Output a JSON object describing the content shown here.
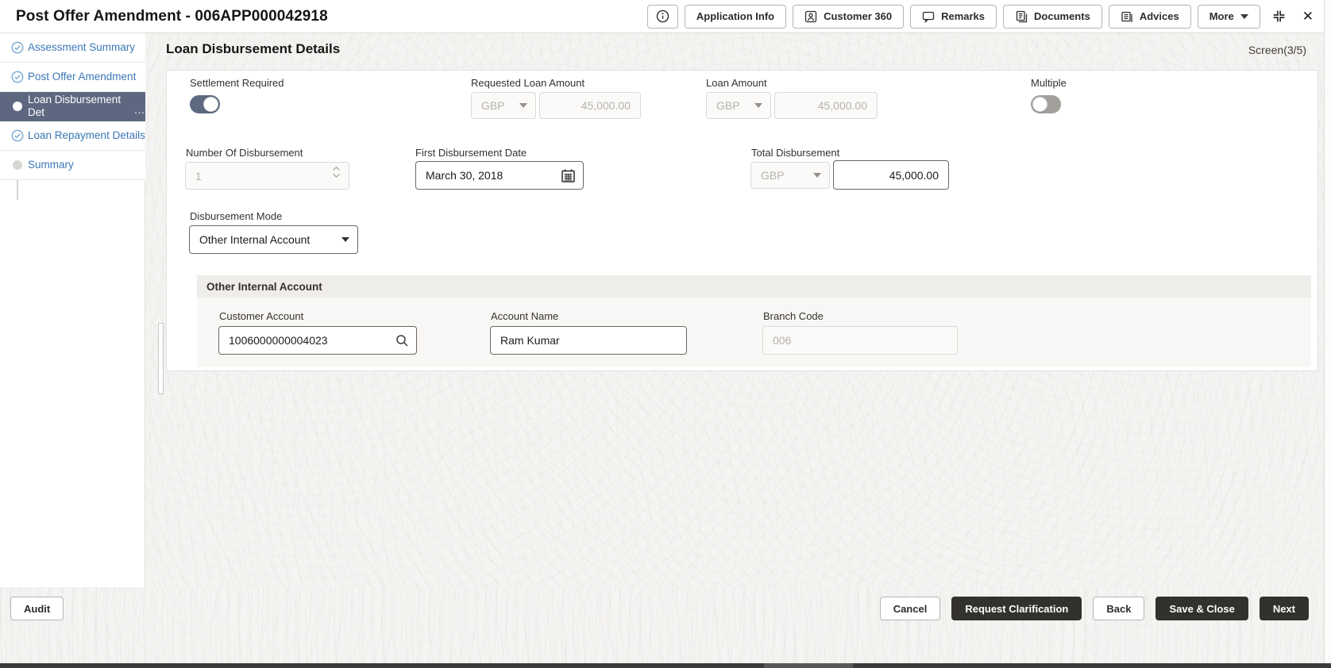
{
  "header": {
    "title": "Post Offer Amendment - 006APP000042918",
    "buttons": {
      "application_info": "Application Info",
      "customer_360": "Customer 360",
      "remarks": "Remarks",
      "documents": "Documents",
      "advices": "Advices",
      "more": "More"
    },
    "close_glyph": "✕"
  },
  "sidebar": {
    "items": [
      {
        "label": "Assessment Summary",
        "state": "completed"
      },
      {
        "label": "Post Offer Amendment",
        "state": "completed"
      },
      {
        "label": "Loan Disbursement Det",
        "ellipsis": "...",
        "state": "active"
      },
      {
        "label": "Loan Repayment Details",
        "state": "completed"
      },
      {
        "label": "Summary",
        "state": "pending"
      }
    ]
  },
  "main": {
    "title": "Loan Disbursement Details",
    "screen_indicator": "Screen(3/5)",
    "fields": {
      "settlement_required": {
        "label": "Settlement Required",
        "value": "on"
      },
      "requested_loan_amount": {
        "label": "Requested Loan Amount",
        "currency": "GBP",
        "amount": "45,000.00",
        "state": "disabled"
      },
      "loan_amount": {
        "label": "Loan Amount",
        "currency": "GBP",
        "amount": "45,000.00",
        "state": "disabled"
      },
      "multiple": {
        "label": "Multiple",
        "value": "off",
        "state": "disabled"
      },
      "number_of_disbursement": {
        "label": "Number Of Disbursement",
        "value": "1",
        "state": "disabled"
      },
      "first_disbursement_date": {
        "label": "First Disbursement Date",
        "value": "March 30, 2018"
      },
      "total_disbursement": {
        "label": "Total Disbursement",
        "currency": "GBP",
        "amount": "45,000.00"
      },
      "disbursement_mode": {
        "label": "Disbursement Mode",
        "value": "Other Internal Account"
      }
    },
    "other_internal_account": {
      "section_title": "Other Internal Account",
      "customer_account": {
        "label": "Customer Account",
        "value": "1006000000004023"
      },
      "account_name": {
        "label": "Account Name",
        "value": "Ram Kumar"
      },
      "branch_code": {
        "label": "Branch Code",
        "value": "006",
        "state": "disabled"
      }
    }
  },
  "footer": {
    "audit": "Audit",
    "cancel": "Cancel",
    "request_clarification": "Request Clarification",
    "back": "Back",
    "save_and_close": "Save & Close",
    "next": "Next"
  },
  "colors": {
    "accent_slate": "#5d6880",
    "link_blue": "#3b77b6",
    "check_blue": "#6fa7d7",
    "dark_button": "#33312d"
  }
}
